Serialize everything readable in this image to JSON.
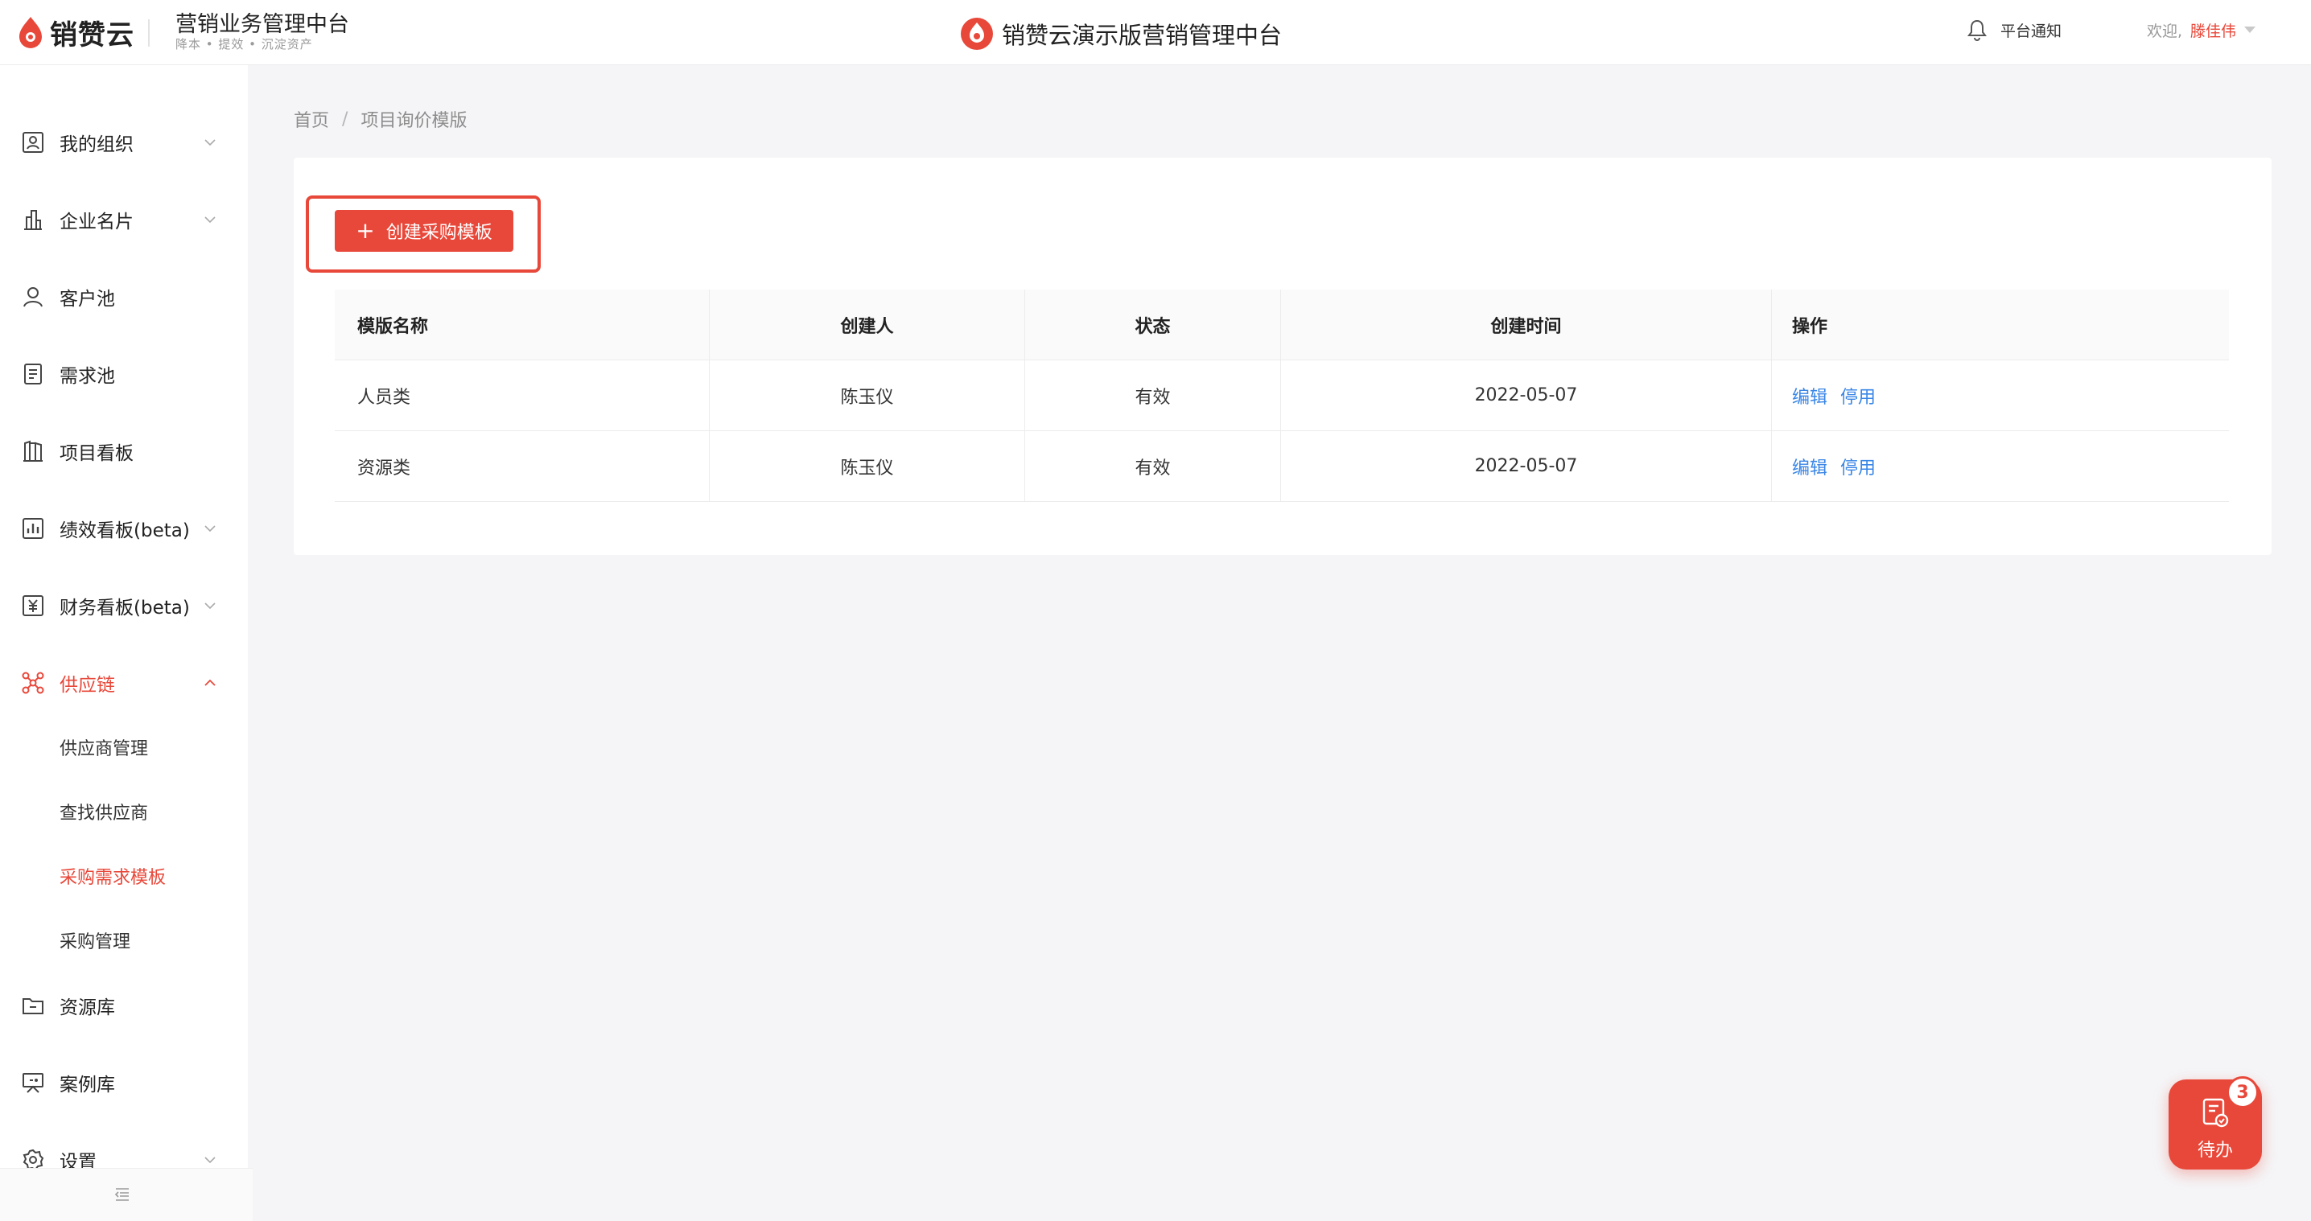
{
  "header": {
    "logo_text": "销赞云",
    "title": "营销业务管理中台",
    "slogan": "降本 • 提效 • 沉淀资产",
    "center_title": "销赞云演示版营销管理中台",
    "notification_label": "平台通知",
    "welcome_label": "欢迎,",
    "user_name": "滕佳伟"
  },
  "sidebar": {
    "items": [
      {
        "label": "我的组织",
        "icon": "org-icon"
      },
      {
        "label": "企业名片",
        "icon": "building-icon"
      },
      {
        "label": "客户池",
        "icon": "user-icon"
      },
      {
        "label": "需求池",
        "icon": "document-icon"
      },
      {
        "label": "项目看板",
        "icon": "kanban-icon"
      },
      {
        "label": "绩效看板(beta)",
        "icon": "chart-icon"
      },
      {
        "label": "财务看板(beta)",
        "icon": "yen-icon"
      },
      {
        "label": "供应链",
        "icon": "network-icon"
      },
      {
        "label": "资源库",
        "icon": "folder-icon"
      },
      {
        "label": "案例库",
        "icon": "presentation-icon"
      },
      {
        "label": "设置",
        "icon": "gear-icon"
      }
    ],
    "supply_chain_sub": [
      "供应商管理",
      "查找供应商",
      "采购需求模板",
      "采购管理"
    ],
    "active_sub": "采购需求模板"
  },
  "breadcrumb": {
    "home": "首页",
    "separator": "/",
    "current": "项目询价模版"
  },
  "toolbar": {
    "create_label": "创建采购模板",
    "create_icon": "plus-icon"
  },
  "table": {
    "headers": [
      "模版名称",
      "创建人",
      "状态",
      "创建时间",
      "操作"
    ],
    "rows": [
      {
        "name": "人员类",
        "creator": "陈玉仪",
        "status": "有效",
        "created": "2022-05-07",
        "actions": [
          "编辑",
          "停用"
        ]
      },
      {
        "name": "资源类",
        "creator": "陈玉仪",
        "status": "有效",
        "created": "2022-05-07",
        "actions": [
          "编辑",
          "停用"
        ]
      }
    ]
  },
  "todo": {
    "label": "待办",
    "count": "3"
  },
  "colors": {
    "accent": "#e8483a",
    "link": "#3a86e6",
    "background": "#f5f5f7"
  }
}
